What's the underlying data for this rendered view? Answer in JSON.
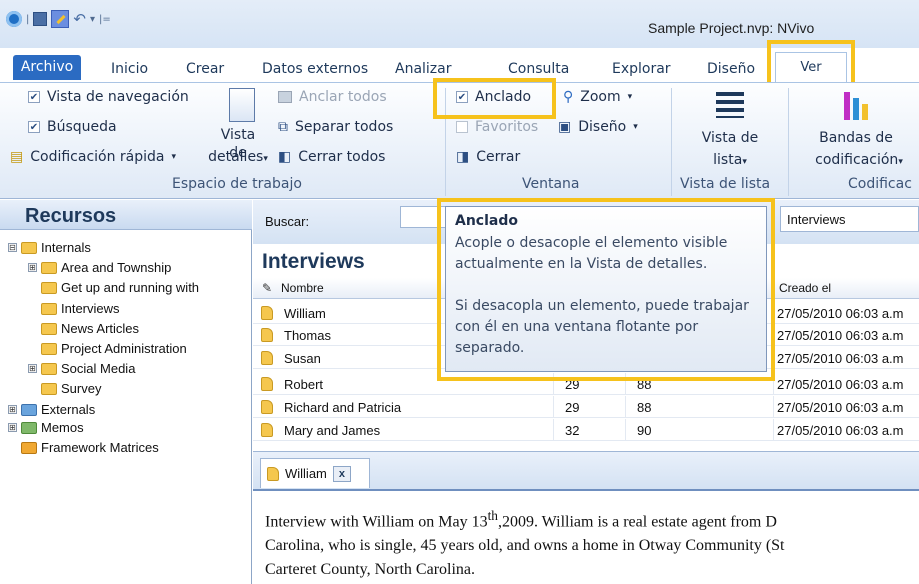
{
  "window": {
    "title": "Sample Project.nvp: NVivo"
  },
  "quick_access": {
    "app_icon": "nvivo-logo-icon",
    "save_icon": "save-icon",
    "edit_icon": "edit-icon",
    "undo_icon": "undo-icon",
    "undo_dropdown": "▾",
    "customize": "|="
  },
  "tabs": [
    "Archivo",
    "Inicio",
    "Crear",
    "Datos externos",
    "Analizar",
    "Consulta",
    "Explorar",
    "Diseño",
    "Ver"
  ],
  "ribbon": {
    "espacio_de_trabajo": {
      "label": "Espacio de trabajo",
      "vista_navegacion": "Vista de navegación",
      "busqueda": "Búsqueda",
      "codificacion_rapida": "Codificación rápida",
      "vista_detalles_line1": "Vista de",
      "vista_detalles_line2": "detalles",
      "anclar_todos": "Anclar todos",
      "separar_todos": "Separar todos",
      "cerrar_todos": "Cerrar todos"
    },
    "ventana": {
      "label": "Ventana",
      "anclado": "Anclado",
      "zoom": "Zoom",
      "favoritos": "Favoritos",
      "diseno": "Diseño",
      "cerrar": "Cerrar"
    },
    "vista_de_lista": {
      "label": "Vista de lista",
      "button_line1": "Vista de",
      "button_line2": "lista"
    },
    "codificacion": {
      "label": "Codificac",
      "button_line1": "Bandas de",
      "button_line2": "codificación"
    }
  },
  "sidebar": {
    "title": "Recursos",
    "items": [
      {
        "label": "Internals",
        "exp": "⊟"
      },
      {
        "label": "Area and Township",
        "exp": "⊞"
      },
      {
        "label": "Get up and running with"
      },
      {
        "label": "Interviews"
      },
      {
        "label": "News Articles"
      },
      {
        "label": "Project Administration"
      },
      {
        "label": "Social Media",
        "exp": "⊞"
      },
      {
        "label": "Survey"
      },
      {
        "label": "Externals",
        "exp": "⊞"
      },
      {
        "label": "Memos",
        "exp": "⊞"
      },
      {
        "label": "Framework Matrices"
      }
    ]
  },
  "search": {
    "label": "Buscar:",
    "scope": "Interviews"
  },
  "list": {
    "title": "Interviews",
    "columns": [
      "Nombre",
      "Creado el"
    ],
    "rows": [
      {
        "name": "William",
        "created": "27/05/2010 06:03 a.m"
      },
      {
        "name": "Thomas",
        "created": "27/05/2010 06:03 a.m"
      },
      {
        "name": "Susan",
        "created": "27/05/2010 06:03 a.m"
      },
      {
        "name": "Robert",
        "n1": "29",
        "n2": "88",
        "created": "27/05/2010 06:03 a.m"
      },
      {
        "name": "Richard and Patricia",
        "n1": "29",
        "n2": "88",
        "created": "27/05/2010 06:03 a.m"
      },
      {
        "name": "Mary and James",
        "n1": "32",
        "n2": "90",
        "created": "27/05/2010 06:03 a.m"
      }
    ]
  },
  "detail": {
    "tab_label": "William",
    "close": "x",
    "text_part1": "Interview with William on May 13",
    "text_sup": "th",
    "text_part2": ",2009.  William is a real estate agent from D",
    "text_line2": "Carolina, who is single, 45 years old, and owns a home in Otway Community (St",
    "text_line3": "Carteret County, North Carolina."
  },
  "tooltip": {
    "title": "Anclado",
    "body": "Acople o desacople el elemento visible actualmente en la Vista de detalles.\n\nSi desacopla un elemento, puede trabajar con él en una ventana flotante por separado."
  },
  "colors": {
    "highlight": "#f6c21c",
    "archivo_tab": "#2b6bc2"
  }
}
